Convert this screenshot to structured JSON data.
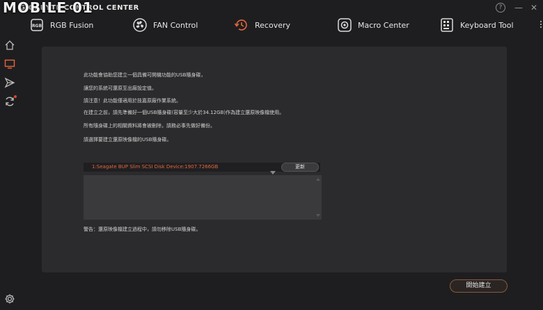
{
  "watermark": "MOBILE 01",
  "app": {
    "title": "GIGABYTE CONTROL CENTER"
  },
  "window_buttons": {
    "help": "?",
    "minimize": "—",
    "close": "✕"
  },
  "nav": {
    "tabs": [
      {
        "label": "RGB Fusion",
        "icon": "rgb-icon",
        "active": false
      },
      {
        "label": "FAN Control",
        "icon": "fan-icon",
        "active": false
      },
      {
        "label": "Recovery",
        "icon": "recovery-icon",
        "active": true
      },
      {
        "label": "Macro Center",
        "icon": "macro-icon",
        "active": false
      },
      {
        "label": "Keyboard Tool",
        "icon": "keyboard-icon",
        "active": false
      }
    ]
  },
  "sidebar": {
    "items": [
      "home-icon",
      "monitor-icon",
      "send-icon",
      "sync-icon",
      "settings-icon"
    ]
  },
  "colors": {
    "accent": "#e5663c",
    "alert_dot": "#e0452b",
    "background": "#1e1e20",
    "panel": "#2b2b2d"
  },
  "main": {
    "info_lines": [
      "此功能會協助您建立一個具備可開機功能的USB隨身碟，",
      "讓您的系統可還原至出廠設定值。",
      "請注意！此功能僅適用於技嘉原廠作業系統。",
      "在建立之前，請先準備好一個USB隨身碟(容量至少大於34.12GB)作為建立還原映像檔使用。",
      "所有隨身碟上的相關資料將會被刪除，請務必事先做好備份。",
      "請選擇要建立還原映像檔的USB隨身碟。"
    ],
    "device_select": "1:Seagate BUP Slim SCSI Disk Device:1907.7266GB",
    "refresh_label": "更新",
    "warning": "警告：還原映像檔建立過程中，請勿移除USB隨身碟。",
    "start_label": "開始建立"
  }
}
